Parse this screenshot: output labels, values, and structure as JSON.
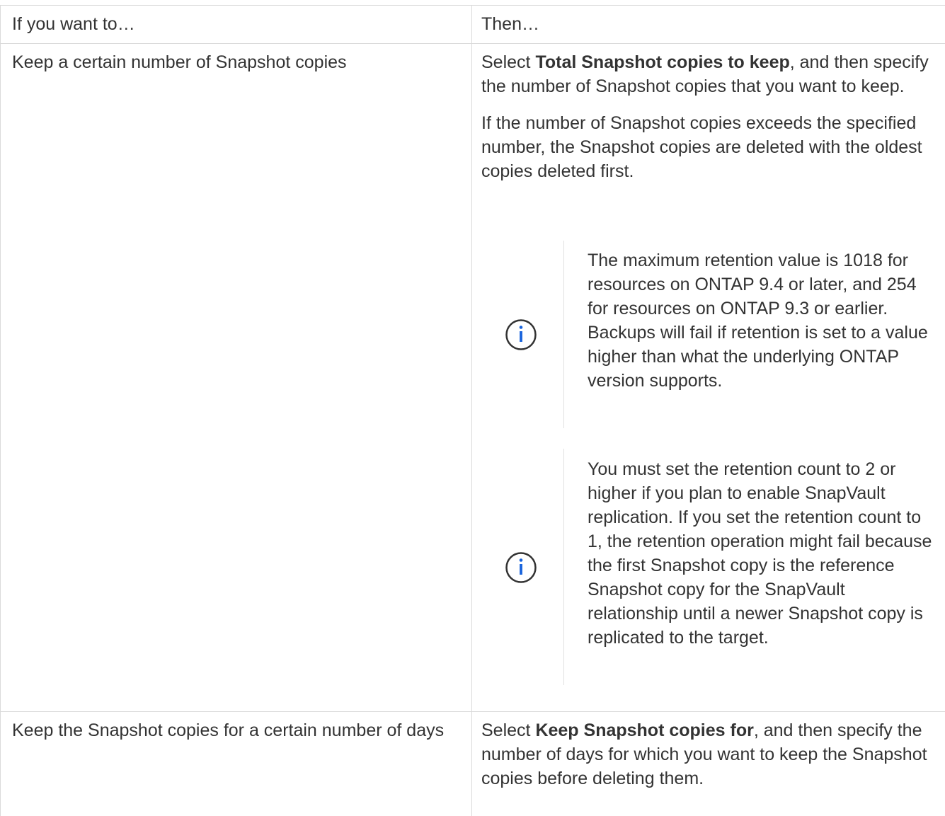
{
  "table": {
    "headers": [
      "If you want to…",
      "Then…"
    ],
    "rows": [
      {
        "condition": "Keep a certain number of Snapshot copies",
        "action": {
          "prefix": "Select ",
          "bold": "Total Snapshot copies to keep",
          "suffix": ", and then specify the number of Snapshot copies that you want to keep."
        },
        "detail": "If the number of Snapshot copies exceeds the specified number, the Snapshot copies are deleted with the oldest copies deleted first.",
        "notes": [
          {
            "icon": "info-circle-icon",
            "text": "The maximum retention value is 1018 for resources on ONTAP 9.4 or later, and 254 for resources on ONTAP 9.3 or earlier. Backups will fail if retention is set to a value higher than what the underlying ONTAP version supports."
          },
          {
            "icon": "info-circle-icon",
            "text": "You must set the retention count to 2 or higher if you plan to enable SnapVault replication. If you set the retention count to 1, the retention operation might fail because the first Snapshot copy is the reference Snapshot copy for the SnapVault relationship until a newer Snapshot copy is replicated to the target."
          }
        ]
      },
      {
        "condition": "Keep the Snapshot copies for a certain number of days",
        "action": {
          "prefix": "Select ",
          "bold": "Keep Snapshot copies for",
          "suffix": ", and then specify the number of days for which you want to keep the Snapshot copies before deleting them."
        }
      }
    ]
  },
  "colors": {
    "text": "#333333",
    "border": "#dadada",
    "icon": "#1863dc"
  }
}
